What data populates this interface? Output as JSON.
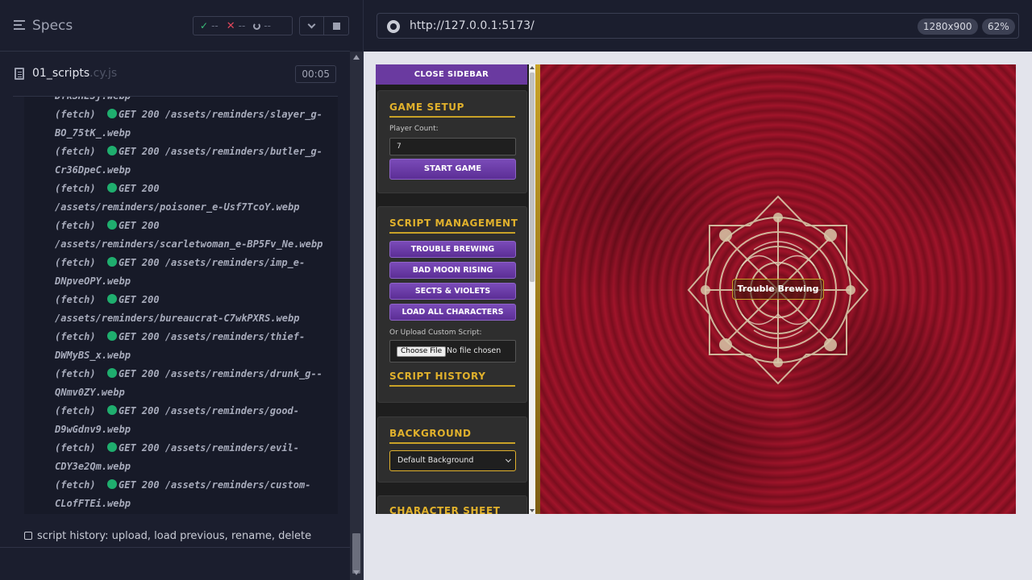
{
  "reporter": {
    "title": "Specs",
    "stats": {
      "passed": "--",
      "failed": "--",
      "pending": "--"
    },
    "spec_file": {
      "name": "01_scripts",
      "ext": ".cy.js",
      "duration": "00:05"
    },
    "log": [
      {
        "prefix": "",
        "text": "DYkSHESj.webp",
        "dot": false
      },
      {
        "prefix": "(fetch)",
        "text": "GET 200 /assets/reminders/slayer_g-",
        "dot": true
      },
      {
        "prefix": "",
        "text": "BO_75tK_.webp",
        "dot": false
      },
      {
        "prefix": "(fetch)",
        "text": "GET 200 /assets/reminders/butler_g-",
        "dot": true
      },
      {
        "prefix": "",
        "text": "Cr36DpeC.webp",
        "dot": false
      },
      {
        "prefix": "(fetch)",
        "text": "GET 200",
        "dot": true
      },
      {
        "prefix": "",
        "text": "/assets/reminders/poisoner_e-Usf7TcoY.webp",
        "dot": false
      },
      {
        "prefix": "(fetch)",
        "text": "GET 200",
        "dot": true
      },
      {
        "prefix": "",
        "text": "/assets/reminders/scarletwoman_e-BP5Fv_Ne.webp",
        "dot": false
      },
      {
        "prefix": "(fetch)",
        "text": "GET 200 /assets/reminders/imp_e-",
        "dot": true
      },
      {
        "prefix": "",
        "text": "DNpveOPY.webp",
        "dot": false
      },
      {
        "prefix": "(fetch)",
        "text": "GET 200",
        "dot": true
      },
      {
        "prefix": "",
        "text": "/assets/reminders/bureaucrat-C7wkPXRS.webp",
        "dot": false
      },
      {
        "prefix": "(fetch)",
        "text": "GET 200 /assets/reminders/thief-",
        "dot": true
      },
      {
        "prefix": "",
        "text": "DWMyBS_x.webp",
        "dot": false
      },
      {
        "prefix": "(fetch)",
        "text": "GET 200 /assets/reminders/drunk_g--",
        "dot": true
      },
      {
        "prefix": "",
        "text": "QNmv0ZY.webp",
        "dot": false
      },
      {
        "prefix": "(fetch)",
        "text": "GET 200 /assets/reminders/good-",
        "dot": true
      },
      {
        "prefix": "",
        "text": "D9wGdnv9.webp",
        "dot": false
      },
      {
        "prefix": "(fetch)",
        "text": "GET 200 /assets/reminders/evil-",
        "dot": true
      },
      {
        "prefix": "",
        "text": "CDY3e2Qm.webp",
        "dot": false
      },
      {
        "prefix": "(fetch)",
        "text": "GET 200 /assets/reminders/custom-",
        "dot": true
      },
      {
        "prefix": "",
        "text": "CLofFTEi.webp",
        "dot": false
      }
    ],
    "test_title": "script history: upload, load previous, rename, delete"
  },
  "browser": {
    "url": "http://127.0.0.1:5173/",
    "viewport": "1280x900",
    "zoom": "62%"
  },
  "app": {
    "close_sidebar": "CLOSE SIDEBAR",
    "game_setup": {
      "title": "GAME SETUP",
      "player_count_label": "Player Count:",
      "player_count_value": "7",
      "start_button": "START GAME"
    },
    "script_management": {
      "title": "SCRIPT MANAGEMENT",
      "buttons": [
        "TROUBLE BREWING",
        "BAD MOON RISING",
        "SECTS & VIOLETS",
        "LOAD ALL CHARACTERS"
      ],
      "upload_label": "Or Upload Custom Script:",
      "choose_file": "Choose File",
      "no_file": "No file chosen",
      "history_title": "SCRIPT HISTORY"
    },
    "background": {
      "title": "BACKGROUND",
      "selected": "Default Background"
    },
    "character_sheet": {
      "title": "CHARACTER SHEET"
    },
    "current_script": "Trouble Brewing"
  },
  "colors": {
    "accent_gold": "#e1b12c",
    "button_purple": "#6a3aa0",
    "pass_green": "#1fae6e",
    "fail_red": "#e0475b",
    "background_red": "#8c1122"
  }
}
